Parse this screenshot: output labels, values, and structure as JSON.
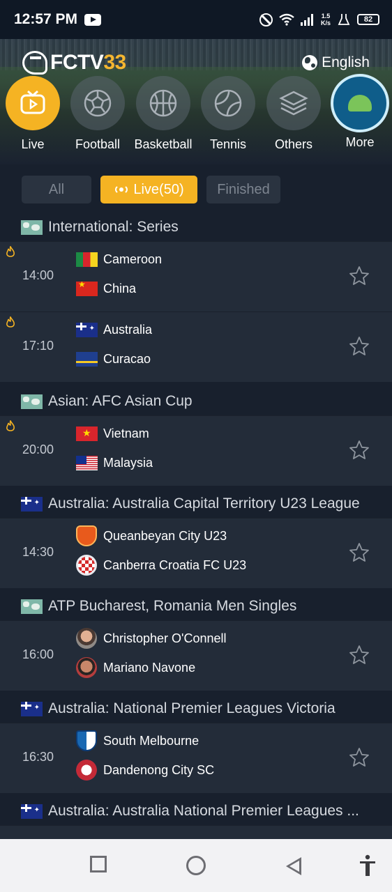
{
  "status_bar": {
    "time": "12:57 PM",
    "net_speed_value": "1.5",
    "net_speed_unit": "K/s",
    "battery": "82"
  },
  "header": {
    "logo_text": "FCTV",
    "logo_number": "33",
    "language": "English"
  },
  "sports": [
    {
      "label": "Live",
      "icon": "live-tv-icon",
      "active": true
    },
    {
      "label": "Football",
      "icon": "football-icon"
    },
    {
      "label": "Basketball",
      "icon": "basketball-icon"
    },
    {
      "label": "Tennis",
      "icon": "tennis-icon"
    },
    {
      "label": "Others",
      "icon": "layers-icon"
    },
    {
      "label": "More",
      "icon": "android-badge-icon"
    }
  ],
  "filters": {
    "all": "All",
    "live": "Live(50)",
    "finished": "Finished"
  },
  "leagues": [
    {
      "name": "International: Series",
      "flag": "world",
      "matches": [
        {
          "time": "14:00",
          "hot": true,
          "home": "Cameroon",
          "home_flag": "cameroon",
          "away": "China",
          "away_flag": "china"
        },
        {
          "time": "17:10",
          "hot": true,
          "home": "Australia",
          "home_flag": "australia",
          "away": "Curacao",
          "away_flag": "curacao"
        }
      ]
    },
    {
      "name": "Asian: AFC Asian Cup",
      "flag": "world",
      "matches": [
        {
          "time": "20:00",
          "hot": true,
          "home": "Vietnam",
          "home_flag": "vietnam",
          "away": "Malaysia",
          "away_flag": "malaysia"
        }
      ]
    },
    {
      "name": "Australia: Australia Capital Territory U23 League",
      "flag": "australia",
      "matches": [
        {
          "time": "14:30",
          "hot": false,
          "home": "Queanbeyan City U23",
          "home_crest": "queanbeyan",
          "away": "Canberra Croatia FC U23",
          "away_crest": "croatia"
        }
      ]
    },
    {
      "name": "ATP Bucharest, Romania Men Singles",
      "flag": "world",
      "matches": [
        {
          "time": "16:00",
          "hot": false,
          "home": "Christopher O'Connell",
          "home_crest": "avatar1",
          "away": "Mariano Navone",
          "away_crest": "avatar2"
        }
      ]
    },
    {
      "name": "Australia: National Premier Leagues Victoria",
      "flag": "australia",
      "matches": [
        {
          "time": "16:30",
          "hot": false,
          "home": "South Melbourne",
          "home_crest": "southmelb",
          "away": "Dandenong City SC",
          "away_crest": "dandenong"
        }
      ]
    },
    {
      "name": "Australia: Australia National Premier Leagues ...",
      "flag": "australia",
      "matches": []
    }
  ],
  "colors": {
    "accent": "#f5b323",
    "background": "#18202d",
    "row": "#232c39"
  }
}
